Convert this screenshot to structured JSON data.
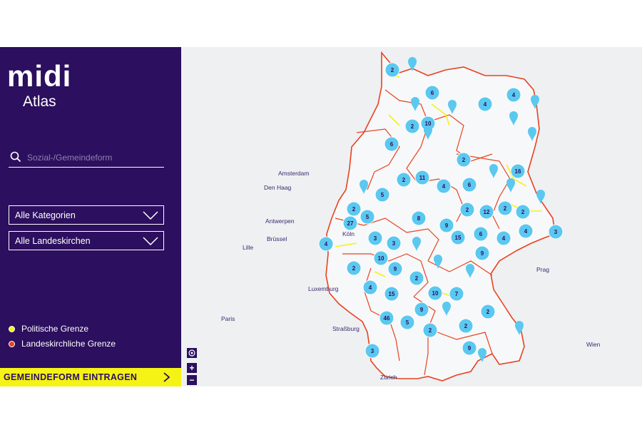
{
  "logo": {
    "brand": "midi",
    "product": "Atlas"
  },
  "search": {
    "placeholder": "Sozial-/Gemeindeform"
  },
  "filters": {
    "category": "Alle Kategorien",
    "church": "Alle Landeskirchen"
  },
  "legend": [
    {
      "label": "Politische Grenze",
      "color": "#f5f215"
    },
    {
      "label": "Landeskirchliche Grenze",
      "color": "#e8421f"
    }
  ],
  "cta": {
    "label": "GEMEINDEFORM EINTRAGEN"
  },
  "controls": {
    "zoom_in": "+",
    "zoom_out": "−"
  },
  "colors": {
    "sidebar": "#2c0f5e",
    "accent": "#f5f215",
    "marker": "#5bc8f0",
    "marker_text": "#2c0f5e",
    "church_border": "#e8421f",
    "political_border": "#f5f215"
  },
  "cities": [
    "Amsterdam",
    "Den Haag",
    "Antwerpen",
    "Brüssel",
    "Lille",
    "Köln",
    "Luxemburg",
    "Paris",
    "Straßburg",
    "Zürich",
    "Prag",
    "Wien"
  ],
  "clusters": [
    "2",
    "6",
    "4",
    "4",
    "2",
    "10",
    "6",
    "2",
    "16",
    "2",
    "11",
    "4",
    "6",
    "5",
    "2",
    "27",
    "2",
    "12",
    "2",
    "2",
    "5",
    "8",
    "9",
    "15",
    "6",
    "4",
    "4",
    "3",
    "3",
    "3",
    "10",
    "9",
    "9",
    "4",
    "2",
    "2",
    "10",
    "7",
    "15",
    "4",
    "9",
    "46",
    "5",
    "2",
    "2",
    "2",
    "9",
    "3"
  ]
}
